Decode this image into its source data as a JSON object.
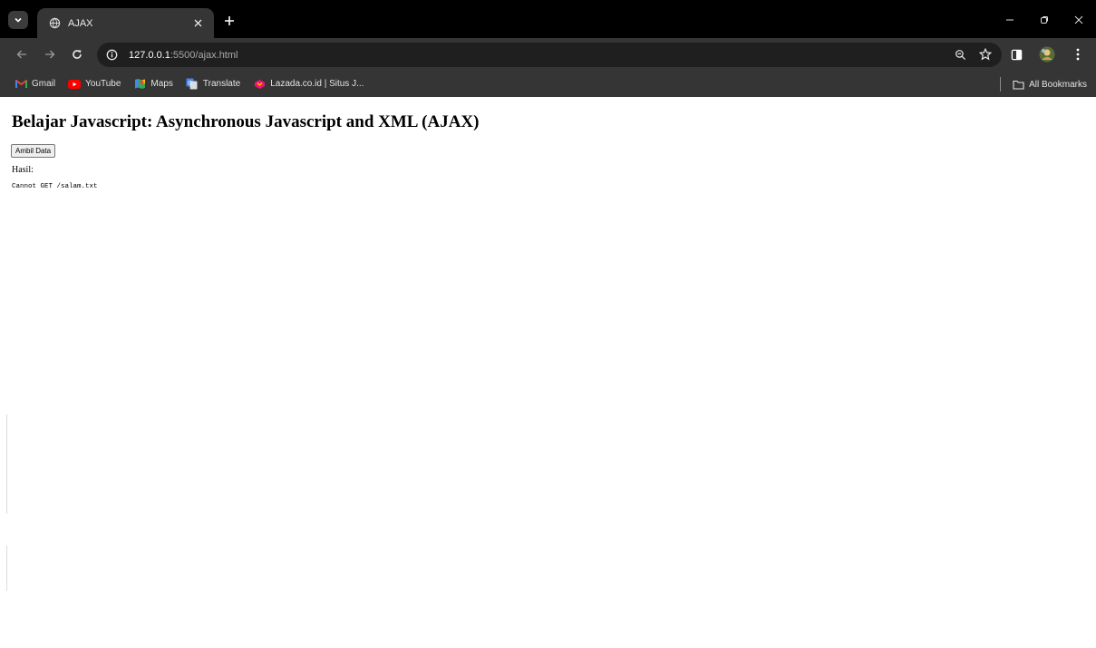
{
  "browser": {
    "tab": {
      "title": "AJAX"
    },
    "address": {
      "host": "127.0.0.1",
      "path": ":5500/ajax.html"
    },
    "bookmarks": [
      {
        "label": "Gmail",
        "icon": "gmail-icon"
      },
      {
        "label": "YouTube",
        "icon": "youtube-icon"
      },
      {
        "label": "Maps",
        "icon": "maps-icon"
      },
      {
        "label": "Translate",
        "icon": "translate-icon"
      },
      {
        "label": "Lazada.co.id | Situs J...",
        "icon": "lazada-icon"
      }
    ],
    "all_bookmarks_label": "All Bookmarks"
  },
  "page": {
    "title": "Belajar Javascript: Asynchronous Javascript and XML (AJAX)",
    "button_label": "Ambil Data",
    "result_label": "Hasil:",
    "result_value": "Cannot GET /salam.txt"
  },
  "colors": {
    "chrome_dark": "#000000",
    "chrome_toolbar": "#353535",
    "omnibox": "#1f1f1f",
    "gmail_red": "#ea4335",
    "youtube_red": "#ff0000",
    "translate_blue": "#4285f4",
    "lazada_pink": "#f0156b"
  }
}
